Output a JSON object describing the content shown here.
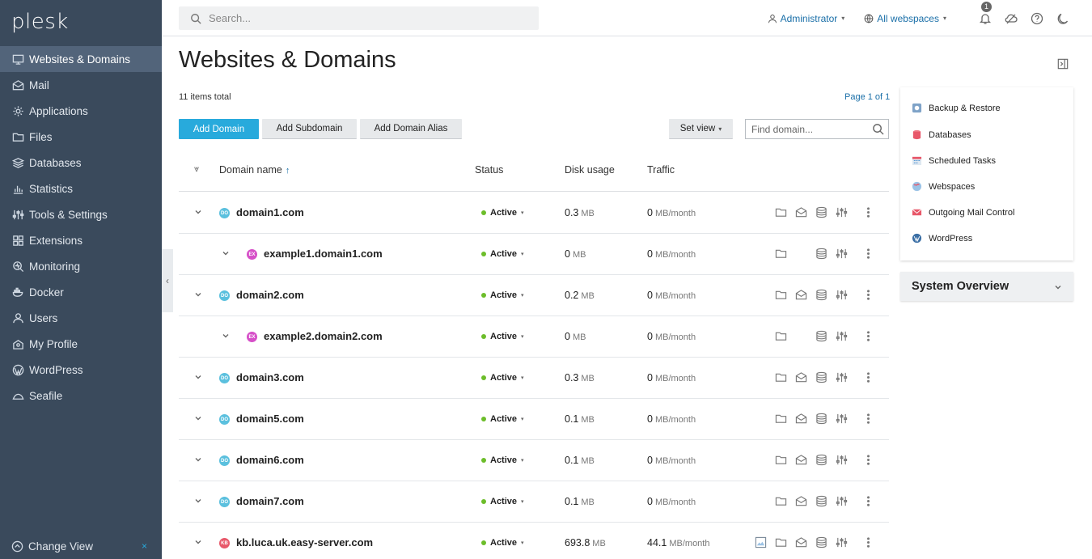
{
  "brand": {
    "logo": "plesk"
  },
  "sidebar": {
    "items": [
      {
        "label": "Websites & Domains",
        "icon": "monitor-icon"
      },
      {
        "label": "Mail",
        "icon": "mail-icon"
      },
      {
        "label": "Applications",
        "icon": "gear-icon"
      },
      {
        "label": "Files",
        "icon": "folder-icon"
      },
      {
        "label": "Databases",
        "icon": "layers-icon"
      },
      {
        "label": "Statistics",
        "icon": "bar-chart-icon"
      },
      {
        "label": "Tools & Settings",
        "icon": "sliders-icon"
      },
      {
        "label": "Extensions",
        "icon": "grid-icon"
      },
      {
        "label": "Monitoring",
        "icon": "monitoring-icon"
      },
      {
        "label": "Docker",
        "icon": "docker-icon"
      },
      {
        "label": "Users",
        "icon": "user-icon"
      },
      {
        "label": "My Profile",
        "icon": "profile-icon"
      },
      {
        "label": "WordPress",
        "icon": "wordpress-icon"
      },
      {
        "label": "Seafile",
        "icon": "seafile-icon"
      }
    ],
    "change_view": "Change View",
    "close_symbol": "×"
  },
  "topbar": {
    "search_placeholder": "Search...",
    "user": "Administrator",
    "webspaces": "All webspaces",
    "notification_count": "1"
  },
  "main": {
    "title": "Websites & Domains",
    "items_total": "11 items total",
    "pagination": "Page 1 of 1",
    "buttons": {
      "add_domain": "Add Domain",
      "add_subdomain": "Add Subdomain",
      "add_alias": "Add Domain Alias",
      "set_view": "Set view"
    },
    "find_placeholder": "Find domain...",
    "columns": {
      "domain": "Domain name",
      "sort_arrow": "↑",
      "status": "Status",
      "disk": "Disk usage",
      "traffic": "Traffic"
    }
  },
  "rows": [
    {
      "name": "domain1.com",
      "sub": false,
      "badge": "DO",
      "badge_color": "#5bc0de",
      "status": "Active",
      "disk": "0.3",
      "disk_unit": "MB",
      "traffic": "0",
      "traffic_unit": "MB/month",
      "mail": true,
      "img": false
    },
    {
      "name": "example1.domain1.com",
      "sub": true,
      "badge": "EX",
      "badge_color": "#d64fc8",
      "status": "Active",
      "disk": "0",
      "disk_unit": "MB",
      "traffic": "0",
      "traffic_unit": "MB/month",
      "mail": false,
      "img": false
    },
    {
      "name": "domain2.com",
      "sub": false,
      "badge": "DO",
      "badge_color": "#5bc0de",
      "status": "Active",
      "disk": "0.2",
      "disk_unit": "MB",
      "traffic": "0",
      "traffic_unit": "MB/month",
      "mail": true,
      "img": false
    },
    {
      "name": "example2.domain2.com",
      "sub": true,
      "badge": "EX",
      "badge_color": "#d64fc8",
      "status": "Active",
      "disk": "0",
      "disk_unit": "MB",
      "traffic": "0",
      "traffic_unit": "MB/month",
      "mail": false,
      "img": false
    },
    {
      "name": "domain3.com",
      "sub": false,
      "badge": "DO",
      "badge_color": "#5bc0de",
      "status": "Active",
      "disk": "0.3",
      "disk_unit": "MB",
      "traffic": "0",
      "traffic_unit": "MB/month",
      "mail": true,
      "img": false
    },
    {
      "name": "domain5.com",
      "sub": false,
      "badge": "DO",
      "badge_color": "#5bc0de",
      "status": "Active",
      "disk": "0.1",
      "disk_unit": "MB",
      "traffic": "0",
      "traffic_unit": "MB/month",
      "mail": true,
      "img": false
    },
    {
      "name": "domain6.com",
      "sub": false,
      "badge": "DO",
      "badge_color": "#5bc0de",
      "status": "Active",
      "disk": "0.1",
      "disk_unit": "MB",
      "traffic": "0",
      "traffic_unit": "MB/month",
      "mail": true,
      "img": false
    },
    {
      "name": "domain7.com",
      "sub": false,
      "badge": "DO",
      "badge_color": "#5bc0de",
      "status": "Active",
      "disk": "0.1",
      "disk_unit": "MB",
      "traffic": "0",
      "traffic_unit": "MB/month",
      "mail": true,
      "img": false
    },
    {
      "name": "kb.luca.uk.easy-server.com",
      "sub": false,
      "badge": "KB",
      "badge_color": "#e8586a",
      "status": "Active",
      "disk": "693.8",
      "disk_unit": "MB",
      "traffic": "44.1",
      "traffic_unit": "MB/month",
      "mail": true,
      "img": true
    }
  ],
  "side_panel": {
    "links": [
      {
        "label": "Backup & Restore",
        "icon": "backup-icon",
        "color": "#6b8fb5"
      },
      {
        "label": "Databases",
        "icon": "database-icon",
        "color": "#e8586a"
      },
      {
        "label": "Scheduled Tasks",
        "icon": "calendar-icon",
        "color": "#e8586a"
      },
      {
        "label": "Webspaces",
        "icon": "webspaces-icon",
        "color": "#5b9bd5"
      },
      {
        "label": "Outgoing Mail Control",
        "icon": "mail-control-icon",
        "color": "#e8586a"
      },
      {
        "label": "WordPress",
        "icon": "wordpress-icon",
        "color": "#3b6fa5"
      }
    ],
    "system_overview": "System Overview"
  },
  "colors": {
    "sidebar": "#3a4a5c",
    "accent": "#28aadc",
    "status_active": "#6cbd2a"
  }
}
